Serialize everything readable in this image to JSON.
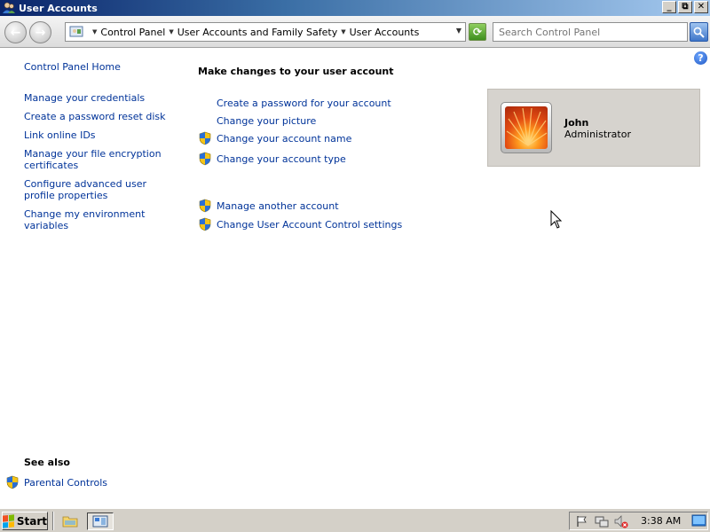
{
  "window": {
    "title": "User Accounts"
  },
  "navbar": {
    "breadcrumb": [
      "Control Panel",
      "User Accounts and Family Safety",
      "User Accounts"
    ],
    "search_placeholder": "Search Control Panel"
  },
  "left_pane": {
    "home_link": "Control Panel Home",
    "tasks": [
      "Manage your credentials",
      "Create a password reset disk",
      "Link online IDs",
      "Manage your file encryption certificates",
      "Configure advanced user profile properties",
      "Change my environment variables"
    ],
    "see_also_title": "See also",
    "see_also_items": [
      "Parental Controls"
    ]
  },
  "main": {
    "heading": "Make changes to your user account",
    "tasks": [
      {
        "label": "Create a password for your account",
        "shield": false
      },
      {
        "label": "Change your picture",
        "shield": false
      },
      {
        "label": "Change your account name",
        "shield": true
      },
      {
        "label": "Change your account type",
        "shield": true
      }
    ],
    "other_tasks": [
      {
        "label": "Manage another account",
        "shield": true
      },
      {
        "label": "Change User Account Control settings",
        "shield": true
      }
    ]
  },
  "user_tile": {
    "name": "John",
    "role": "Administrator"
  },
  "taskbar": {
    "start_label": "Start",
    "clock": "3:38 AM"
  },
  "colors": {
    "link": "#003399",
    "title_bar": "#0a246a",
    "tile_bg": "#d6d3ce",
    "taskbar_bg": "#d4d0c8"
  }
}
